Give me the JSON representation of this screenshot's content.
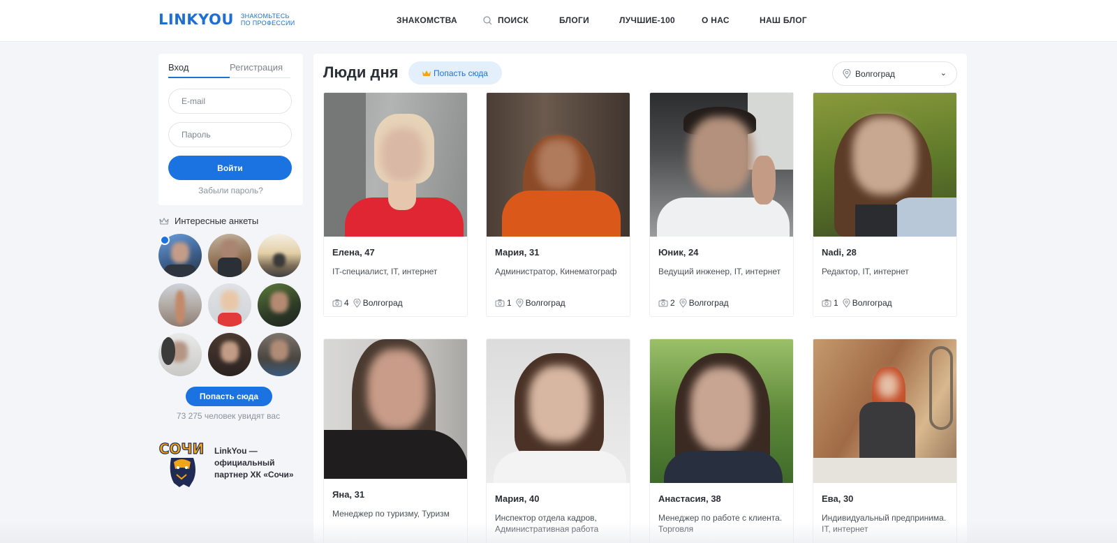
{
  "header": {
    "logo": "LINKYOU",
    "tagline_line1": "ЗНАКОМЬТЕСЬ",
    "tagline_line2": "ПО ПРОФЕССИИ",
    "nav": [
      "ЗНАКОМСТВА",
      "ПОИСК",
      "БЛОГИ",
      "ЛУЧШИЕ-100",
      "О НАС",
      "НАШ БЛОГ"
    ]
  },
  "login": {
    "tab_login": "Вход",
    "tab_register": "Регистрация",
    "email_placeholder": "E-mail",
    "password_placeholder": "Пароль",
    "submit": "Войти",
    "forgot": "Забыли пароль?"
  },
  "sidebar": {
    "interesting_title": "Интересные анкеты",
    "cta": "Попасть сюда",
    "viewers": "73 275 человек увидят вас",
    "partner": "LinkYou — официальный партнер ХК «Сочи»",
    "partner_logo_text": "СОЧИ"
  },
  "main": {
    "title": "Люди дня",
    "cta": "Попасть сюда",
    "city": "Волгоград",
    "cards": [
      {
        "name": "Елена, 47",
        "job": "IT-специалист, IT, интернет",
        "photos": "4",
        "city": "Волгоград"
      },
      {
        "name": "Мария, 31",
        "job": "Администратор, Кинематограф",
        "photos": "1",
        "city": "Волгоград"
      },
      {
        "name": "Юник, 24",
        "job": "Ведущий инженер, IT, интернет",
        "photos": "2",
        "city": "Волгоград"
      },
      {
        "name": "Nadi, 28",
        "job": "Редактор, IT, интернет",
        "photos": "1",
        "city": "Волгоград"
      },
      {
        "name": "Яна, 31",
        "job": "Менеджер по туризму, Туризм"
      },
      {
        "name": "Мария, 40",
        "job": "Инспектор отдела кадров, Административная работа"
      },
      {
        "name": "Анастасия, 38",
        "job": "Менеджер по работе с клиента... Торговля",
        "job_line1": "Менеджер по работе с клиента.",
        "job_line2": "Торговля"
      },
      {
        "name": "Ева, 30",
        "job_line1": "Индивидуальный предпринима.",
        "job_line2": "IT, интернет"
      }
    ]
  },
  "colors": {
    "brand": "#1e6fd1",
    "button": "#1a73e0",
    "page_bg": "#f3f5f9"
  }
}
